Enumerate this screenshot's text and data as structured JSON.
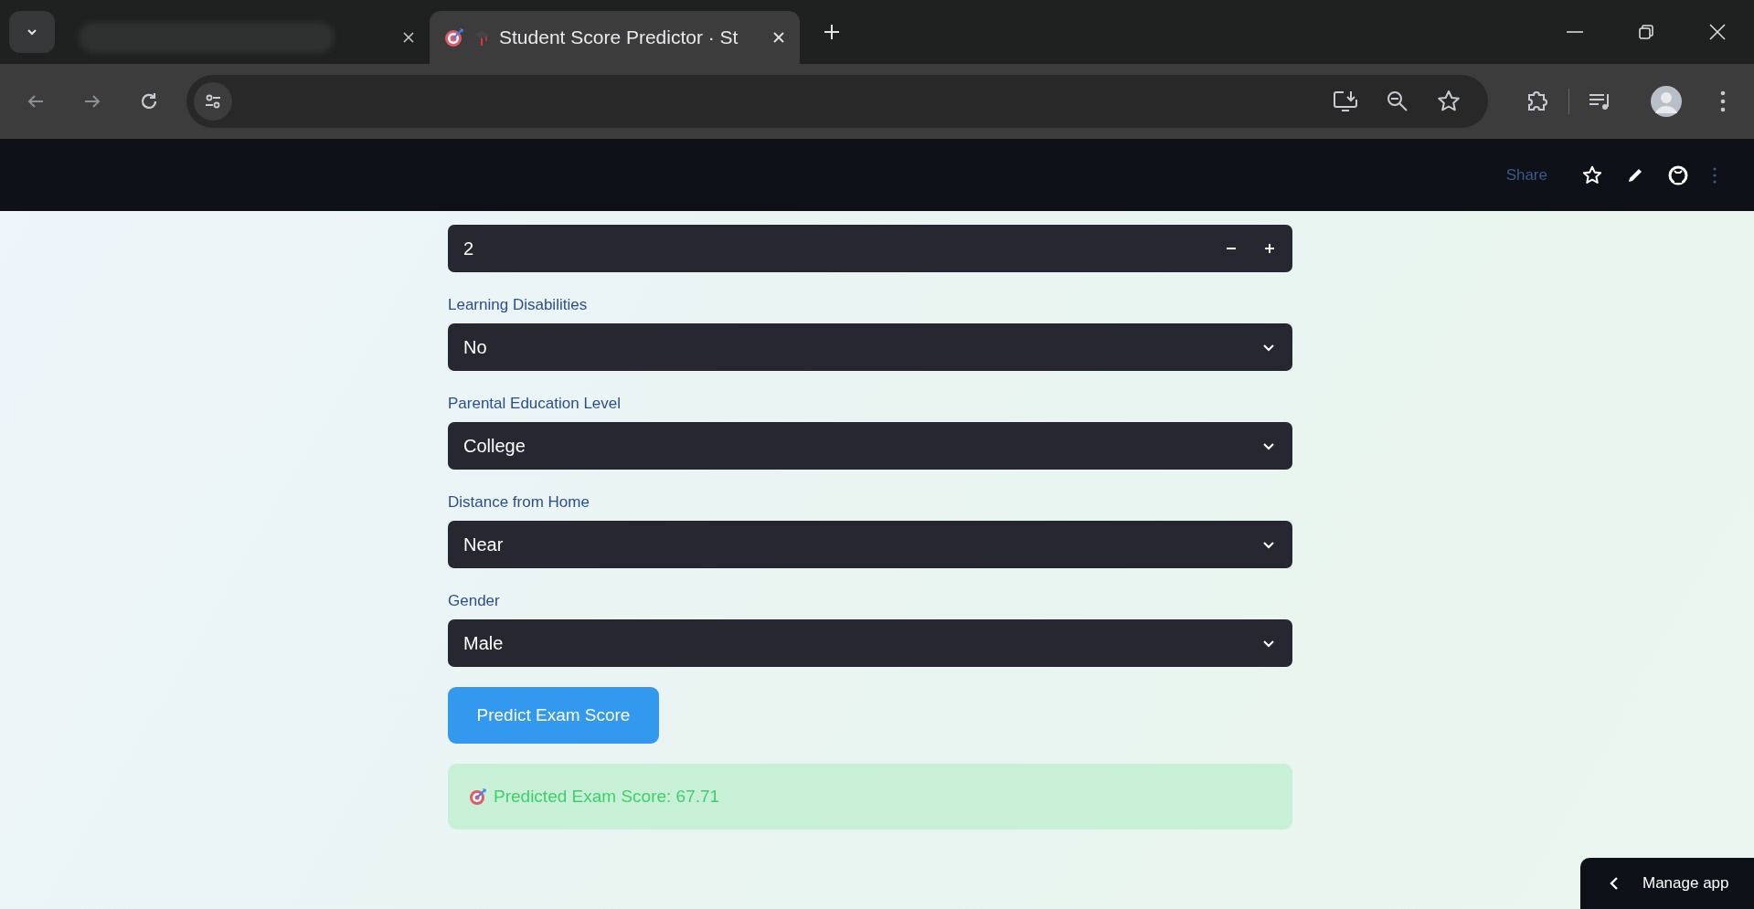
{
  "browser": {
    "tabs": [
      {
        "kind": "redacted",
        "selected": false
      },
      {
        "kind": "page",
        "title": "Student Score Predictor · St",
        "selected": true
      }
    ]
  },
  "app_header": {
    "share": "Share"
  },
  "fields": [
    {
      "kind": "number",
      "value": "2"
    },
    {
      "kind": "select",
      "label": "Learning Disabilities",
      "value": "No"
    },
    {
      "kind": "select",
      "label": "Parental Education Level",
      "value": "College"
    },
    {
      "kind": "select",
      "label": "Distance from Home",
      "value": "Near"
    },
    {
      "kind": "select",
      "label": "Gender",
      "value": "Male"
    }
  ],
  "predict_button": "Predict Exam Score",
  "result": {
    "text": "Predicted Exam Score: 67.71"
  },
  "manage_app": "Manage app"
}
